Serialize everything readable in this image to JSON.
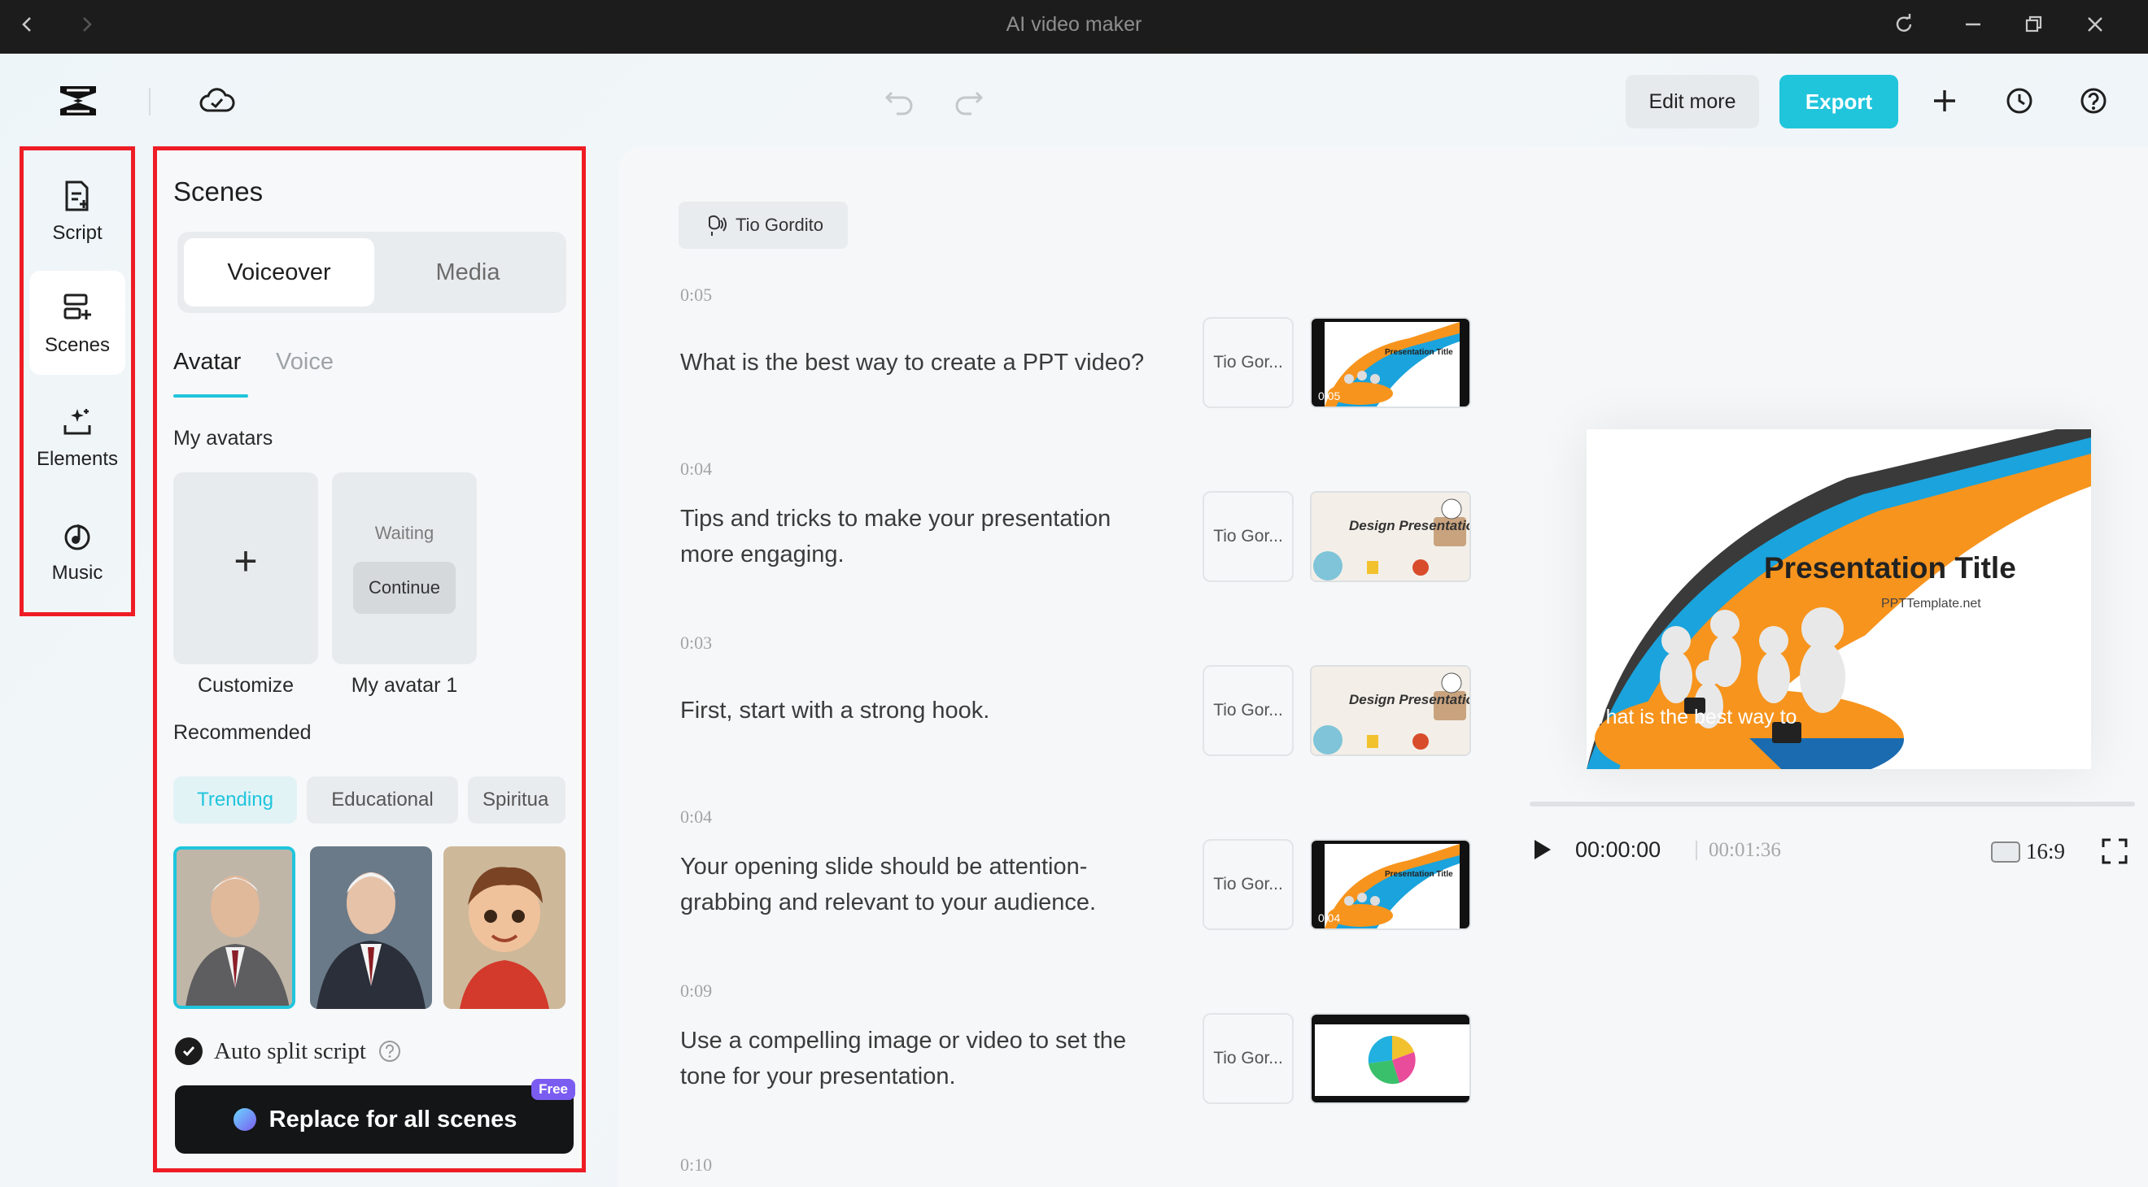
{
  "window": {
    "title": "AI video maker"
  },
  "toolbar": {
    "edit_more": "Edit more",
    "export": "Export"
  },
  "rail": {
    "items": [
      {
        "label": "Script",
        "icon": "script-icon"
      },
      {
        "label": "Scenes",
        "icon": "scenes-icon",
        "active": true
      },
      {
        "label": "Elements",
        "icon": "elements-icon"
      },
      {
        "label": "Music",
        "icon": "music-icon"
      }
    ]
  },
  "panel": {
    "title": "Scenes",
    "segments": [
      "Voiceover",
      "Media"
    ],
    "subtabs": [
      "Avatar",
      "Voice"
    ],
    "my_avatars_heading": "My avatars",
    "avatars": {
      "customize": "Customize",
      "avatar1_status": "Waiting",
      "avatar1_action": "Continue",
      "avatar1_label": "My avatar 1"
    },
    "recommended_heading": "Recommended",
    "chips": [
      "Trending",
      "Educational",
      "Spiritua"
    ],
    "auto_split": "Auto split script",
    "replace_button": "Replace for all scenes",
    "free_badge": "Free"
  },
  "main": {
    "speaker": "Tio Gordito",
    "rows": [
      {
        "time": "0:05",
        "text": "What is the best way to create a PPT video?",
        "voice": "Tio Gor..."
      },
      {
        "time": "0:04",
        "text": "Tips and tricks to make your presentation more engaging.",
        "voice": "Tio Gor..."
      },
      {
        "time": "0:03",
        "text": "First, start with a strong hook.",
        "voice": "Tio Gor..."
      },
      {
        "time": "0:04",
        "text": "Your opening slide should be attention-grabbing and relevant to your audience.",
        "voice": "Tio Gor..."
      },
      {
        "time": "0:09",
        "text": "Use a compelling image or video to set the tone for your presentation.",
        "voice": "Tio Gor..."
      },
      {
        "time": "0:10"
      }
    ],
    "slides": {
      "presentation_title": "Presentation Title",
      "design_presentations": "Design Presentations",
      "slide_time": "0:05"
    }
  },
  "preview": {
    "title": "Presentation Title",
    "subtitle": "PPTTemplate.net",
    "caption": "What is the best way to",
    "current_time": "00:00:00",
    "duration": "00:01:36",
    "aspect": "16:9"
  },
  "colors": {
    "accent": "#20c5dc",
    "highlight_border": "#ee1c25"
  }
}
